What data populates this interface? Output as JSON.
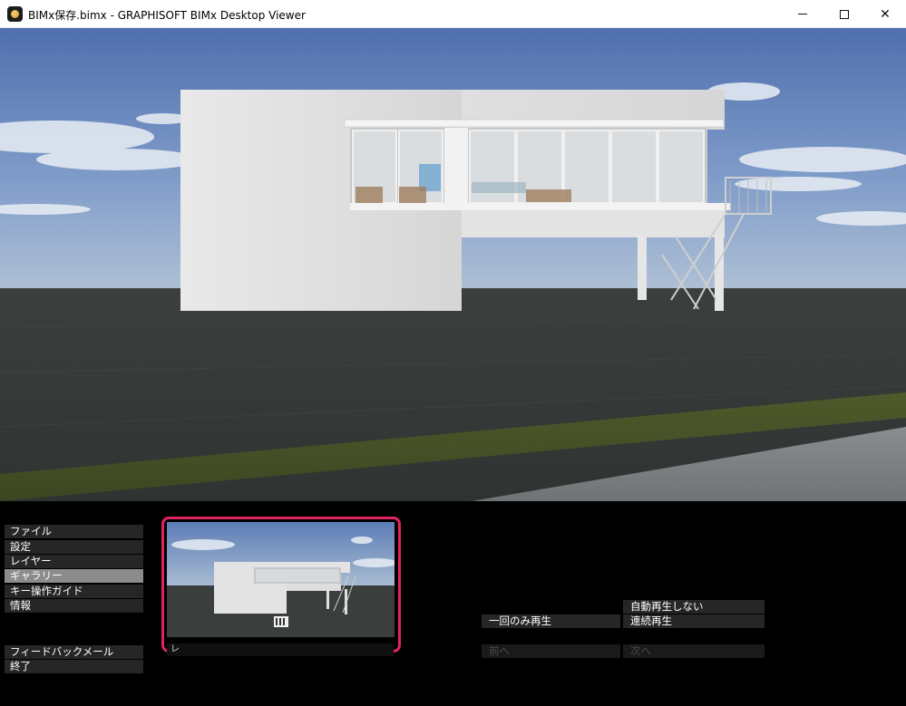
{
  "window": {
    "title": "BIMx保存.bimx - GRAPHISOFT BIMx Desktop Viewer",
    "minimize_glyph": "—",
    "close_glyph": "✕"
  },
  "menu": {
    "items": [
      {
        "label": "ファイル",
        "active": false
      },
      {
        "label": "設定",
        "active": false
      },
      {
        "label": "レイヤー",
        "active": false
      },
      {
        "label": "ギャラリー",
        "active": true
      },
      {
        "label": "キー操作ガイド",
        "active": false
      },
      {
        "label": "情報",
        "active": false
      }
    ],
    "feedback_label": "フィードバックメール",
    "exit_label": "終了"
  },
  "gallery": {
    "caption": "レ"
  },
  "playback": {
    "no_autoplay_label": "自動再生しない",
    "play_once_label": "一回のみ再生",
    "continuous_label": "連続再生",
    "prev_label": "前へ",
    "next_label": "次へ"
  },
  "colors": {
    "highlight_border": "#e0245e",
    "menu_bg": "#262626",
    "menu_active_bg": "#8c8c8c"
  },
  "icons": {
    "app": "bimx-app-icon",
    "minimize": "minimize-icon",
    "maximize": "maximize-icon",
    "close": "close-icon"
  }
}
